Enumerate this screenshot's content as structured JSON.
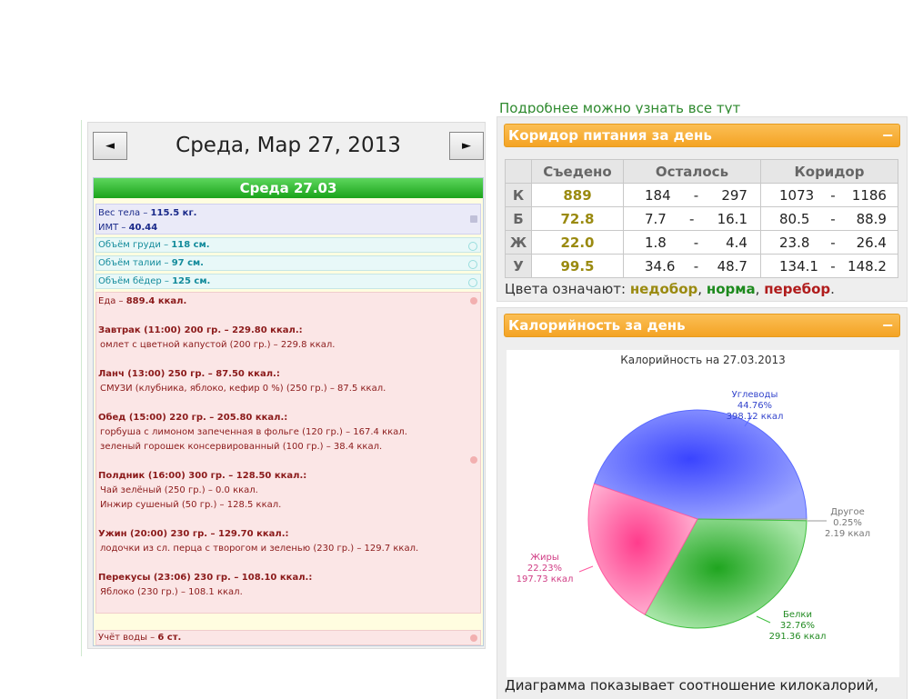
{
  "top_cut_text": "Подробнее можно узнать все тут",
  "diary": {
    "date_title": "Среда, Мар 27, 2013",
    "prev_label": "◄",
    "next_label": "►",
    "day_header": "Среда 27.03",
    "weight_label": "Вес тела – ",
    "weight_value": "115.5 кг.",
    "bmi_label": "ИМТ – ",
    "bmi_value": "40.44",
    "chest_label": "Объём груди – ",
    "chest_value": "118 см.",
    "waist_label": "Объём талии – ",
    "waist_value": "97 см.",
    "hips_label": "Объём бёдер – ",
    "hips_value": "125 см.",
    "food_label": "Еда – ",
    "food_value": "889.4 ккал.",
    "meals": [
      {
        "title": "Завтрак (11:00) 200 гр. – 229.80 ккал.:",
        "items": [
          "омлет с цветной капустой (200 гр.) – 229.8 ккал."
        ]
      },
      {
        "title": "Ланч (13:00) 250 гр. – 87.50 ккал.:",
        "items": [
          "СМУЗИ (клубника, яблоко, кефир 0 %) (250 гр.) – 87.5 ккал."
        ]
      },
      {
        "title": "Обед (15:00) 220 гр. – 205.80 ккал.:",
        "items": [
          "горбуша с лимоном запеченная в фольге (120 гр.) – 167.4 ккал.",
          "зеленый горошек консервированный (100 гр.) – 38.4 ккал."
        ]
      },
      {
        "title": "Полдник (16:00) 300 гр. – 128.50 ккал.:",
        "items": [
          "Чай зелёный (250 гр.) – 0.0 ккал.",
          "Инжир сушеный (50 гр.) – 128.5 ккал."
        ]
      },
      {
        "title": "Ужин (20:00) 230 гр. – 129.70 ккал.:",
        "items": [
          "лодочки из сл. перца с творогом и зеленью (230 гр.) – 129.7 ккал."
        ]
      },
      {
        "title": "Перекусы (23:06) 230 гр. – 108.10 ккал.:",
        "items": [
          "Яблоко (230 гр.) – 108.1 ккал."
        ]
      }
    ],
    "water_label": "Учёт воды – ",
    "water_value": "6 ст."
  },
  "corridor": {
    "header": "Коридор питания за день",
    "collapse": "−",
    "columns": [
      "Съедено",
      "Осталось",
      "Коридор"
    ],
    "rows": [
      {
        "label": "К",
        "eaten": "889",
        "left_min": "184",
        "left_max": "297",
        "cor_min": "1073",
        "cor_max": "1186"
      },
      {
        "label": "Б",
        "eaten": "72.8",
        "left_min": "7.7",
        "left_max": "16.1",
        "cor_min": "80.5",
        "cor_max": "88.9"
      },
      {
        "label": "Ж",
        "eaten": "22.0",
        "left_min": "1.8",
        "left_max": "4.4",
        "cor_min": "23.8",
        "cor_max": "26.4"
      },
      {
        "label": "У",
        "eaten": "99.5",
        "left_min": "34.6",
        "left_max": "48.7",
        "cor_min": "134.1",
        "cor_max": "148.2"
      }
    ],
    "dash": "-",
    "legend_prefix": "Цвета означают: ",
    "legend_under": "недобор",
    "legend_sep": ", ",
    "legend_norm": "норма",
    "legend_over": "перебор",
    "legend_end": "."
  },
  "calories": {
    "header": "Калорийность за день",
    "collapse": "−",
    "caption": "Диаграмма показывает соотношение килокалорий,"
  },
  "chart_data": {
    "type": "pie",
    "title": "Калорийность на 27.03.2013",
    "slices": [
      {
        "name": "Углеводы",
        "percent": 44.76,
        "percent_label": "44.76%",
        "value_label": "398.12 ккал",
        "color": "#5b6bff"
      },
      {
        "name": "Другое",
        "percent": 0.25,
        "percent_label": "0.25%",
        "value_label": "2.19 ккал",
        "color": "#9a9a9a"
      },
      {
        "name": "Белки",
        "percent": 32.76,
        "percent_label": "32.76%",
        "value_label": "291.36 ккал",
        "color": "#3fbf3f"
      },
      {
        "name": "Жиры",
        "percent": 22.23,
        "percent_label": "22.23%",
        "value_label": "197.73 ккал",
        "color": "#ff5aa0"
      }
    ],
    "label_colors": {
      "Углеводы": "#3344cc",
      "Другое": "#777777",
      "Белки": "#228b22",
      "Жиры": "#d03c84"
    }
  }
}
